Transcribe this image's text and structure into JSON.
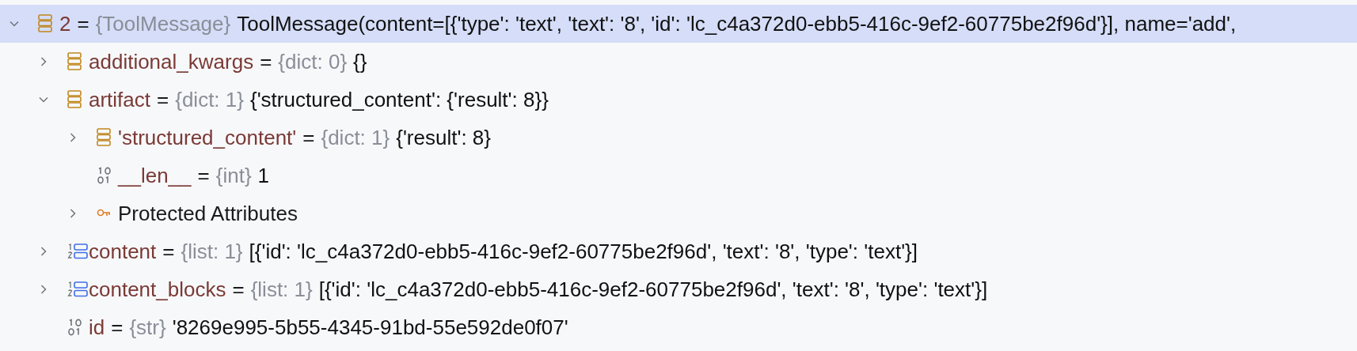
{
  "variables": [
    {
      "kind": "dict",
      "name": "2",
      "separator": "=",
      "type": "{ToolMessage}",
      "value": "ToolMessage(content=[{'type': 'text', 'text': '8', 'id': 'lc_c4a372d0-ebb5-416c-9ef2-60775be2f96d'}], name='add',",
      "selected": true,
      "expanded": true,
      "children": [
        {
          "kind": "dict",
          "name": "additional_kwargs",
          "separator": "=",
          "type": "{dict: 0}",
          "value": "{}",
          "selected": false,
          "expanded": false
        },
        {
          "kind": "dict",
          "name": "artifact",
          "separator": "=",
          "type": "{dict: 1}",
          "value": "{'structured_content': {'result': 8}}",
          "selected": false,
          "expanded": true,
          "children": [
            {
              "kind": "dict",
              "name": "'structured_content'",
              "separator": "=",
              "type": "{dict: 1}",
              "value": "{'result': 8}",
              "selected": false,
              "expanded": false
            },
            {
              "kind": "int",
              "name": "__len__",
              "separator": "=",
              "type": "{int}",
              "value": "1",
              "selected": false
            },
            {
              "kind": "group",
              "name": "Protected Attributes",
              "selected": false,
              "expanded": false
            }
          ]
        },
        {
          "kind": "list",
          "name": "content",
          "separator": "=",
          "type": "{list: 1}",
          "value": "[{'id': 'lc_c4a372d0-ebb5-416c-9ef2-60775be2f96d', 'text': '8', 'type': 'text'}]",
          "selected": false,
          "expanded": false
        },
        {
          "kind": "list",
          "name": "content_blocks",
          "separator": "=",
          "type": "{list: 1}",
          "value": "[{'id': 'lc_c4a372d0-ebb5-416c-9ef2-60775be2f96d', 'text': '8', 'type': 'text'}]",
          "selected": false,
          "expanded": false
        },
        {
          "kind": "int",
          "name": "id",
          "separator": "=",
          "type": "{str}",
          "value": "'8269e995-5b55-4345-91bd-55e592de0f07'",
          "selected": false
        }
      ]
    }
  ]
}
